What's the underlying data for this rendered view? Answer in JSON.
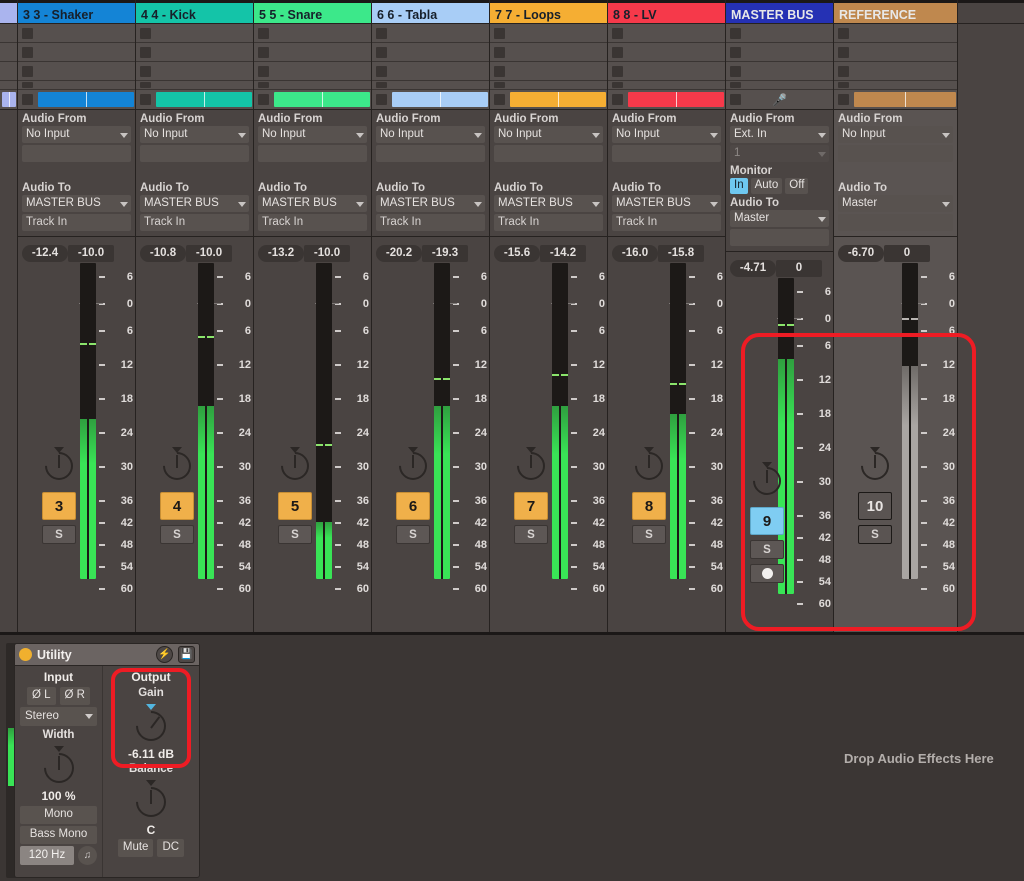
{
  "app": {
    "view": "Session Mixer",
    "drop_hint": "Drop Audio Effects Here"
  },
  "colors": {
    "accent_selected": "#7fcdf2",
    "track_number": "#f0b04a",
    "annotation": "#ee1c24",
    "meter_green": "#39e456",
    "meter_muted": "#a9a5a2"
  },
  "io_labels": {
    "audio_from": "Audio From",
    "audio_to": "Audio To",
    "monitor": "Monitor",
    "monitor_in": "In",
    "monitor_auto": "Auto",
    "monitor_off": "Off",
    "track_in": "Track In"
  },
  "meter_scale": [
    "6",
    "0",
    "6",
    "12",
    "18",
    "24",
    "30",
    "36",
    "42",
    "48",
    "54",
    "60"
  ],
  "tracks": [
    {
      "id": "partial-left",
      "name": "",
      "header_color": "#aab4ee",
      "header_fg": "dark",
      "clip_color": "#aab4ee",
      "partial": true
    },
    {
      "id": "shaker",
      "name": "3 3 - Shaker",
      "header_color": "#1484d6",
      "header_fg": "dark",
      "clip_color": "#1484d6",
      "audio_from": "No Input",
      "audio_from_sub": "",
      "audio_to": "MASTER BUS",
      "audio_to_sub": "Track In",
      "peak": "-12.4",
      "volume": "-10.0",
      "number": "3",
      "number_state": "normal",
      "solo": "S",
      "armed": false,
      "muted": false,
      "meter_db": -29.5,
      "meter_peak_db": -12.4
    },
    {
      "id": "kick",
      "name": "4 4 - Kick",
      "header_color": "#14c4a8",
      "header_fg": "dark",
      "clip_color": "#14c4a8",
      "audio_from": "No Input",
      "audio_from_sub": "",
      "audio_to": "MASTER BUS",
      "audio_to_sub": "Track In",
      "peak": "-10.8",
      "volume": "-10.0",
      "number": "4",
      "number_state": "normal",
      "solo": "S",
      "armed": false,
      "muted": false,
      "meter_db": -26.5,
      "meter_peak_db": -10.8
    },
    {
      "id": "snare",
      "name": "5 5 - Snare",
      "header_color": "#3ce88a",
      "header_fg": "dark",
      "clip_color": "#3ce88a",
      "audio_from": "No Input",
      "audio_from_sub": "",
      "audio_to": "MASTER BUS",
      "audio_to_sub": "Track In",
      "peak": "-13.2",
      "volume": "-10.0",
      "number": "5",
      "number_state": "normal",
      "solo": "S",
      "armed": false,
      "muted": false,
      "meter_db": -53.0,
      "meter_peak_db": -35.5
    },
    {
      "id": "tabla",
      "name": "6 6 - Tabla",
      "header_color": "#a8cdf6",
      "header_fg": "dark",
      "clip_color": "#a8cdf6",
      "audio_from": "No Input",
      "audio_from_sub": "",
      "audio_to": "MASTER BUS",
      "audio_to_sub": "Track In",
      "peak": "-20.2",
      "volume": "-19.3",
      "number": "6",
      "number_state": "normal",
      "solo": "S",
      "armed": false,
      "muted": false,
      "meter_db": -26.5,
      "meter_peak_db": -20.5
    },
    {
      "id": "loops",
      "name": "7 7 - Loops",
      "header_color": "#f5ae33",
      "header_fg": "dark",
      "clip_color": "#f5ae33",
      "audio_from": "No Input",
      "audio_from_sub": "",
      "audio_to": "MASTER BUS",
      "audio_to_sub": "Track In",
      "peak": "-15.6",
      "volume": "-14.2",
      "number": "7",
      "number_state": "normal",
      "solo": "S",
      "armed": false,
      "muted": false,
      "meter_db": -26.5,
      "meter_peak_db": -19.5
    },
    {
      "id": "lv",
      "name": "8 8 - LV",
      "header_color": "#f6394a",
      "header_fg": "dark",
      "clip_color": "#f6394a",
      "audio_from": "No Input",
      "audio_from_sub": "",
      "audio_to": "MASTER BUS",
      "audio_to_sub": "Track In",
      "peak": "-16.0",
      "volume": "-15.8",
      "number": "8",
      "number_state": "normal",
      "solo": "S",
      "armed": false,
      "muted": false,
      "meter_db": -28.5,
      "meter_peak_db": -21.5
    },
    {
      "id": "master-bus",
      "name": "MASTER BUS",
      "header_color": "#2531b4",
      "header_fg": "light",
      "clip_color": null,
      "clip_icon": "microphone-icon",
      "audio_from": "Ext. In",
      "audio_from_sub": "1",
      "audio_to": "Master",
      "audio_to_sub": "",
      "has_monitor": true,
      "monitor_state": "In",
      "peak": "-4.71",
      "volume": "0",
      "number": "9",
      "number_state": "selected",
      "solo": "S",
      "armed": true,
      "muted": false,
      "meter_db": -12.5,
      "meter_peak_db": -4.7
    },
    {
      "id": "reference",
      "name": "REFERENCE",
      "header_color": "#bf884e",
      "header_fg": "light",
      "clip_color": "#bf884e",
      "audio_from": "No Input",
      "audio_from_sub": "",
      "audio_to": "Master",
      "audio_to_sub": "",
      "peak": "-6.70",
      "volume": "0",
      "number": "10",
      "number_state": "off",
      "solo": "S",
      "armed": false,
      "muted": true,
      "meter_db": -17.5,
      "meter_peak_db": -6.7
    }
  ],
  "device": {
    "title": "Utility",
    "power_icon": "power-toggle-icon",
    "save_icon": "save-disk-icon",
    "input": {
      "section": "Input",
      "phase_l": "Ø L",
      "phase_r": "Ø R",
      "channel_mode": "Stereo",
      "width_label": "Width",
      "width_value": "100 %",
      "mono_label": "Mono",
      "bass_mono_label": "Bass Mono",
      "bass_mono_freq": "120 Hz",
      "headphone_icon": "headphone-icon"
    },
    "output": {
      "section": "Output",
      "gain_label": "Gain",
      "gain_value": "-6.11 dB",
      "balance_label": "Balance",
      "balance_value": "C",
      "mute_label": "Mute",
      "dc_label": "DC"
    }
  },
  "annotations": [
    {
      "name": "master-bus-reference-strips-highlight",
      "shape": "rounded-rect"
    },
    {
      "name": "utility-gain-highlight",
      "shape": "rounded-rect"
    }
  ]
}
